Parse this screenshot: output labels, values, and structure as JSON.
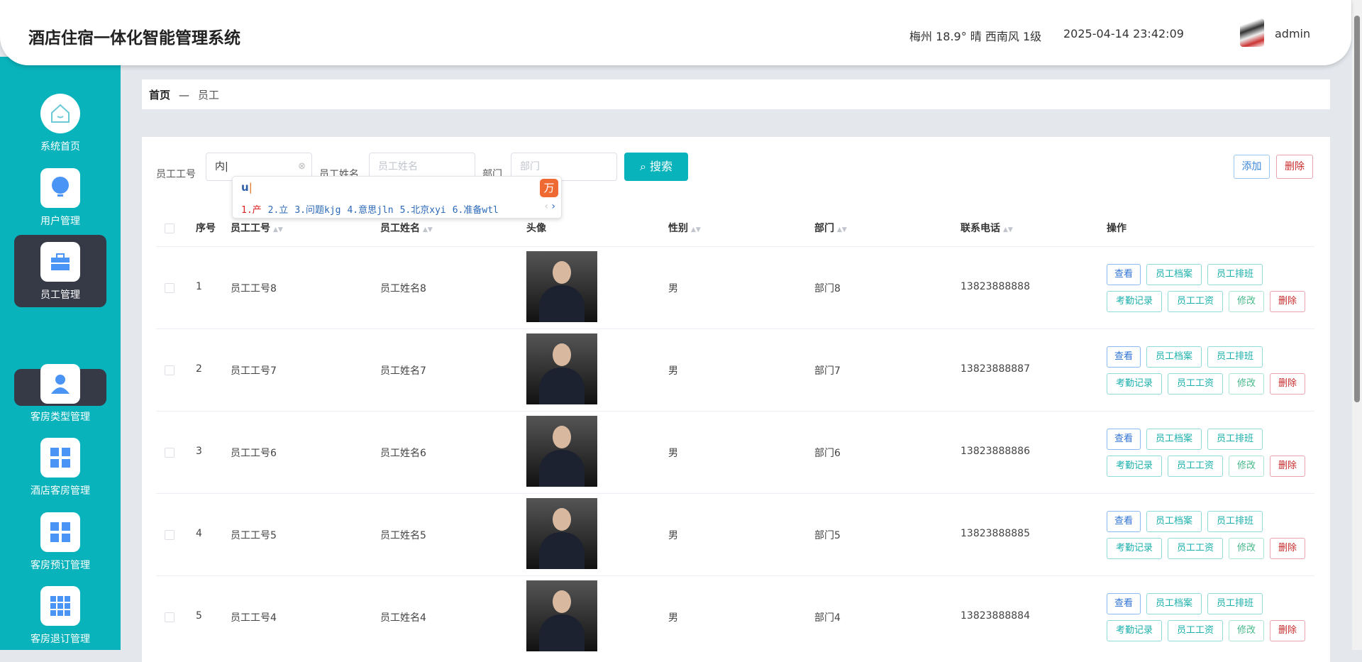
{
  "header": {
    "title": "酒店住宿一体化智能管理系统",
    "weather": "梅州  18.9°  晴  西南风  1级",
    "datetime": "2025-04-14 23:42:09",
    "username": "admin"
  },
  "sidebar": {
    "items": [
      {
        "label": "系统首页",
        "icon": "home-icon"
      },
      {
        "label": "用户管理",
        "icon": "bulb-icon"
      },
      {
        "label": "员工管理",
        "icon": "briefcase-icon"
      },
      {
        "label": "客房类型管理",
        "icon": "user-icon"
      },
      {
        "label": "酒店客房管理",
        "icon": "grid-icon"
      },
      {
        "label": "客房预订管理",
        "icon": "grid-icon"
      },
      {
        "label": "客房退订管理",
        "icon": "apps-icon"
      }
    ],
    "sub_item": "员工"
  },
  "breadcrumb": {
    "home": "首页",
    "sep": "—",
    "current": "员工"
  },
  "search": {
    "id_label": "员工工号",
    "id_value": "内",
    "name_label": "员工姓名",
    "name_placeholder": "员工姓名",
    "dept_label": "部门",
    "dept_placeholder": "部门",
    "button": "搜索"
  },
  "actions": {
    "add": "添加",
    "delete": "删除"
  },
  "ime": {
    "composition": "u",
    "candidates": [
      "1.产",
      "2.立",
      "3.问题kjg",
      "4.意思jln",
      "5.北京xyi",
      "6.准备wtl"
    ]
  },
  "table": {
    "headers": [
      "序号",
      "员工工号",
      "员工姓名",
      "头像",
      "性别",
      "部门",
      "联系电话",
      "操作"
    ],
    "rows": [
      {
        "no": "1",
        "id": "员工工号8",
        "name": "员工姓名8",
        "gender": "男",
        "dept": "部门8",
        "phone": "13823888888"
      },
      {
        "no": "2",
        "id": "员工工号7",
        "name": "员工姓名7",
        "gender": "男",
        "dept": "部门7",
        "phone": "13823888887"
      },
      {
        "no": "3",
        "id": "员工工号6",
        "name": "员工姓名6",
        "gender": "男",
        "dept": "部门6",
        "phone": "13823888886"
      },
      {
        "no": "4",
        "id": "员工工号5",
        "name": "员工姓名5",
        "gender": "男",
        "dept": "部门5",
        "phone": "13823888885"
      },
      {
        "no": "5",
        "id": "员工工号4",
        "name": "员工姓名4",
        "gender": "男",
        "dept": "部门4",
        "phone": "13823888884"
      }
    ],
    "row_actions": [
      "查看",
      "员工档案",
      "员工排班",
      "考勤记录",
      "员工工资",
      "修改",
      "删除"
    ]
  },
  "colors": {
    "teal": "#08b3bc",
    "sidebar_active": "#353a46"
  }
}
